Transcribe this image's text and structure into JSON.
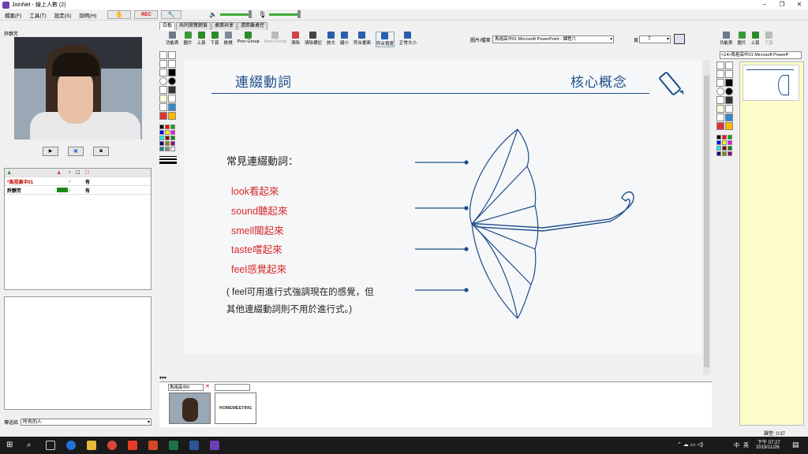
{
  "window": {
    "title": "JoinNet - 線上人數 (2)"
  },
  "menu": {
    "items": [
      "檔案(F)",
      "工具(T)",
      "設定(S)",
      "說明(H)"
    ],
    "rec_label": "REC"
  },
  "video": {
    "name": "許靜芳"
  },
  "participants": {
    "rows": [
      {
        "name": "*馬祖高中01",
        "check": "✓",
        "status": "有"
      },
      {
        "name": "許靜芳",
        "check": "✓",
        "status": "有"
      }
    ]
  },
  "sendto": {
    "label": "傳送給",
    "value": "所有的人"
  },
  "tabs": [
    "白板",
    "共同瀏覽網頁",
    "桌面共享",
    "遠距離桌控"
  ],
  "toolbar": {
    "buttons": [
      "功能表",
      "圖片",
      "上頁",
      "下頁",
      "檢視",
      "Prev Group",
      "Next Group",
      "清除",
      "清除標記",
      "放大",
      "縮小",
      "符合畫面",
      "符合寬度",
      "正常大小"
    ],
    "file_label": "圖片/檔案",
    "file_value": "馬祖高中01 Microsoft PowerPoint - 課程六",
    "page_label": "頁",
    "page_value": "7"
  },
  "slide": {
    "title_left": "連綴動詞",
    "title_right": "核心概念",
    "heading": "常見連綴動詞：",
    "verbs": [
      "look看起來",
      "sound聽起來",
      "smell聞起來",
      "taste嚐起來",
      "feel感覺起來"
    ],
    "note_line1": "( feel可用進行式強調現在的感覺，但",
    "note_line2": "其他連綴動詞則不用於進行式。)"
  },
  "thumbs": {
    "select_value": "馬祖高中0",
    "logo_text": "HOMEMEETING"
  },
  "right_panel": {
    "buttons": [
      "功能表",
      "圖片",
      "上頁",
      "下頁"
    ],
    "select_value": "<14>馬祖高中01 Microsoft PowerP"
  },
  "status": {
    "clock_label": "課堂: 0:37"
  },
  "tray": {
    "time": "下午 07:27",
    "date": "2019/11/26",
    "ime": "中",
    "lang": "英"
  },
  "colors": {
    "title_blue": "#1e4f8a",
    "verb_red": "#d62a2a",
    "note_yellow": "#fcfcc8"
  }
}
